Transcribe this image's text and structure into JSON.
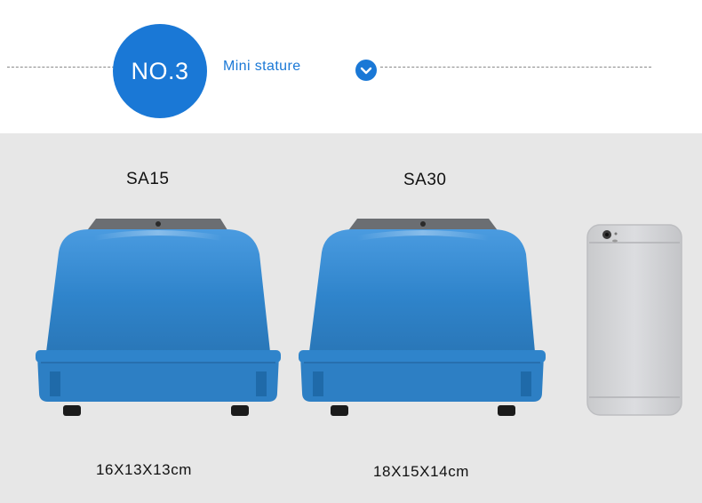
{
  "header": {
    "badge_text": "NO.3",
    "subtitle": "Mini stature",
    "accent_color": "#1a78d6",
    "chevron_icon": "chevron-down-icon"
  },
  "products": [
    {
      "model": "SA15",
      "dimensions": "16X13X13cm",
      "color": "#2e82c7"
    },
    {
      "model": "SA30",
      "dimensions": "18X15X14cm",
      "color": "#2e82c7"
    }
  ],
  "reference_object": {
    "icon": "smartphone-silver"
  }
}
